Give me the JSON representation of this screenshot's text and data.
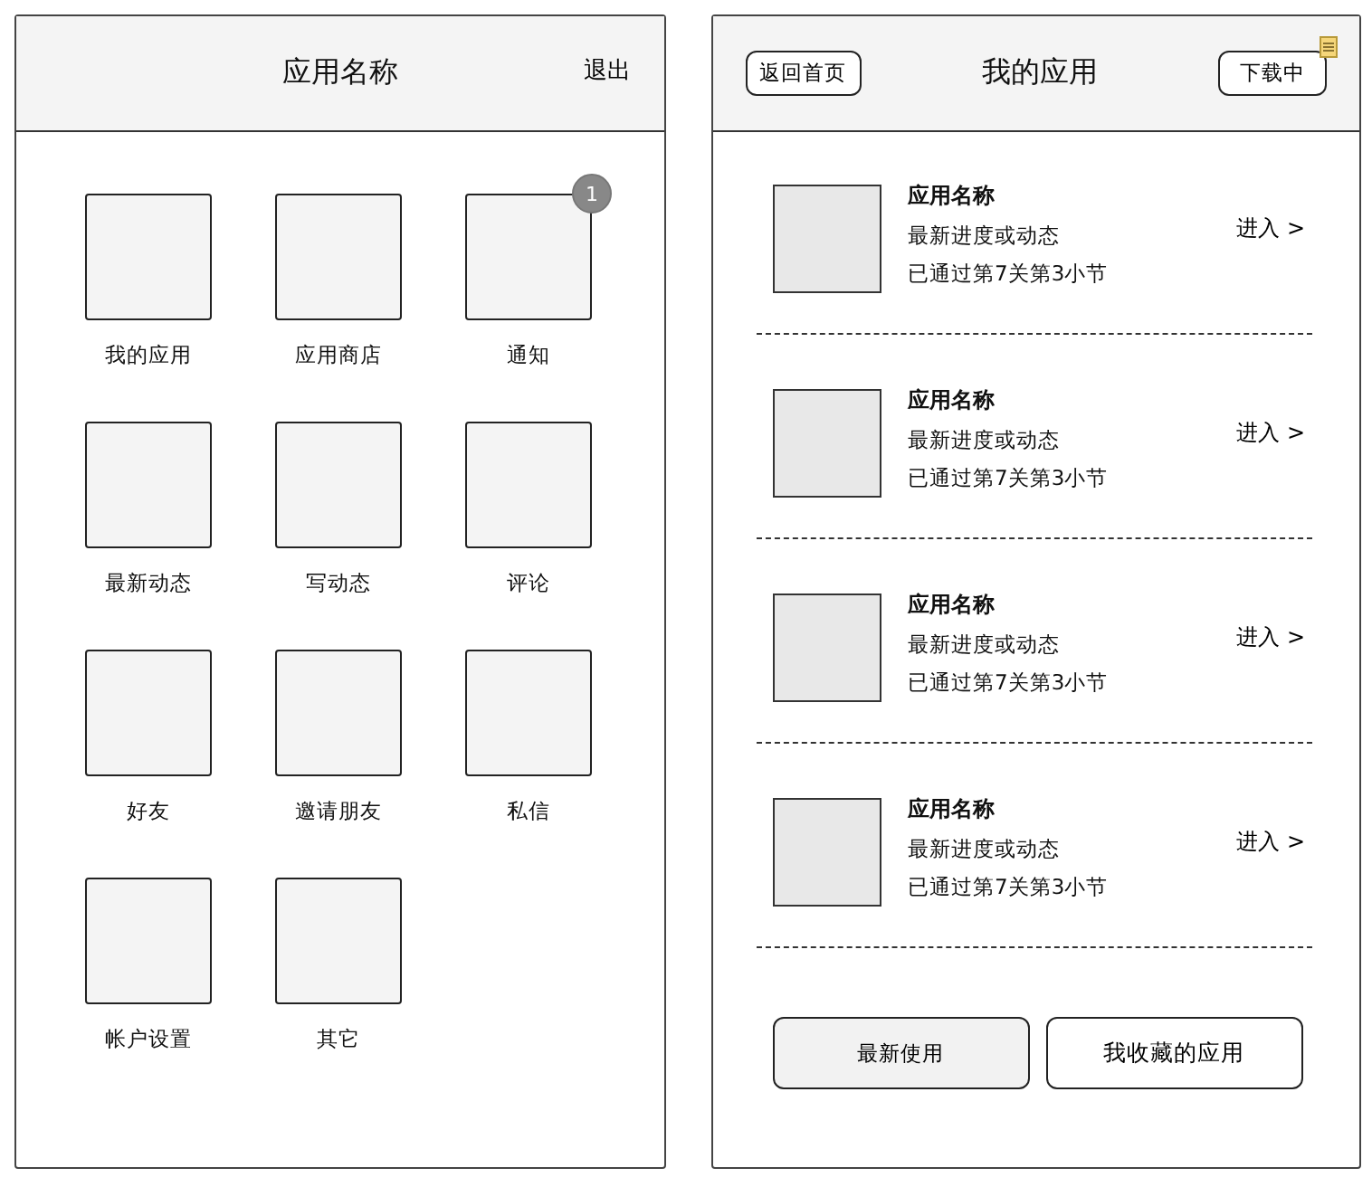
{
  "home": {
    "title": "应用名称",
    "logout": "退出",
    "tiles": [
      {
        "label": "我的应用"
      },
      {
        "label": "应用商店"
      },
      {
        "label": "通知",
        "badge": "1"
      },
      {
        "label": "最新动态"
      },
      {
        "label": "写动态"
      },
      {
        "label": "评论"
      },
      {
        "label": "好友"
      },
      {
        "label": "邀请朋友"
      },
      {
        "label": "私信"
      },
      {
        "label": "帐户设置"
      },
      {
        "label": "其它"
      }
    ]
  },
  "my_apps": {
    "back": "返回首页",
    "title": "我的应用",
    "downloading": "下载中",
    "items": [
      {
        "name": "应用名称",
        "status": "最新进度或动态",
        "progress": "已通过第7关第3小节",
        "enter": "进入 >"
      },
      {
        "name": "应用名称",
        "status": "最新进度或动态",
        "progress": "已通过第7关第3小节",
        "enter": "进入 >"
      },
      {
        "name": "应用名称",
        "status": "最新进度或动态",
        "progress": "已通过第7关第3小节",
        "enter": "进入 >"
      },
      {
        "name": "应用名称",
        "status": "最新进度或动态",
        "progress": "已通过第7关第3小节",
        "enter": "进入 >"
      }
    ],
    "tabs": [
      {
        "label": "最新使用",
        "selected": true
      },
      {
        "label": "我收藏的应用",
        "selected": false
      }
    ]
  }
}
